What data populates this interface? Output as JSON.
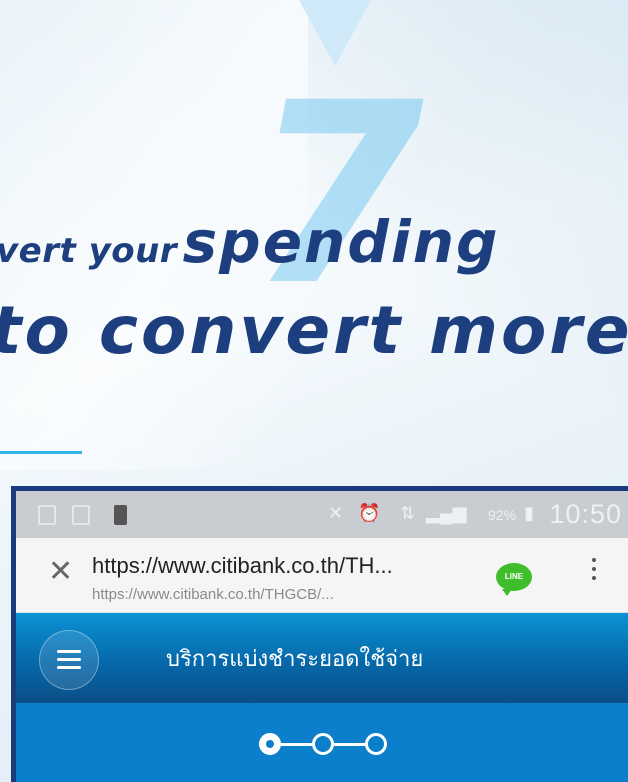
{
  "headline": {
    "line1_prefix": "vert your",
    "line1_emphasis": "spending",
    "line2": "to convert more",
    "big_number": "7"
  },
  "status_bar": {
    "battery": "92%",
    "time": "10:50"
  },
  "browser": {
    "url": "https://www.citibank.co.th/TH...",
    "url_sub": "https://www.citibank.co.th/THGCB/...",
    "line_icon_label": "LINE"
  },
  "app": {
    "title": "บริการแบ่งชำระยอดใช้จ่าย"
  },
  "steps": {
    "count": 3,
    "current": 1
  },
  "colors": {
    "brand_navy": "#1d3f7f",
    "accent_cyan": "#35b5ea",
    "citi_blue": "#0b7fcc",
    "line_green": "#3fbd2b"
  }
}
